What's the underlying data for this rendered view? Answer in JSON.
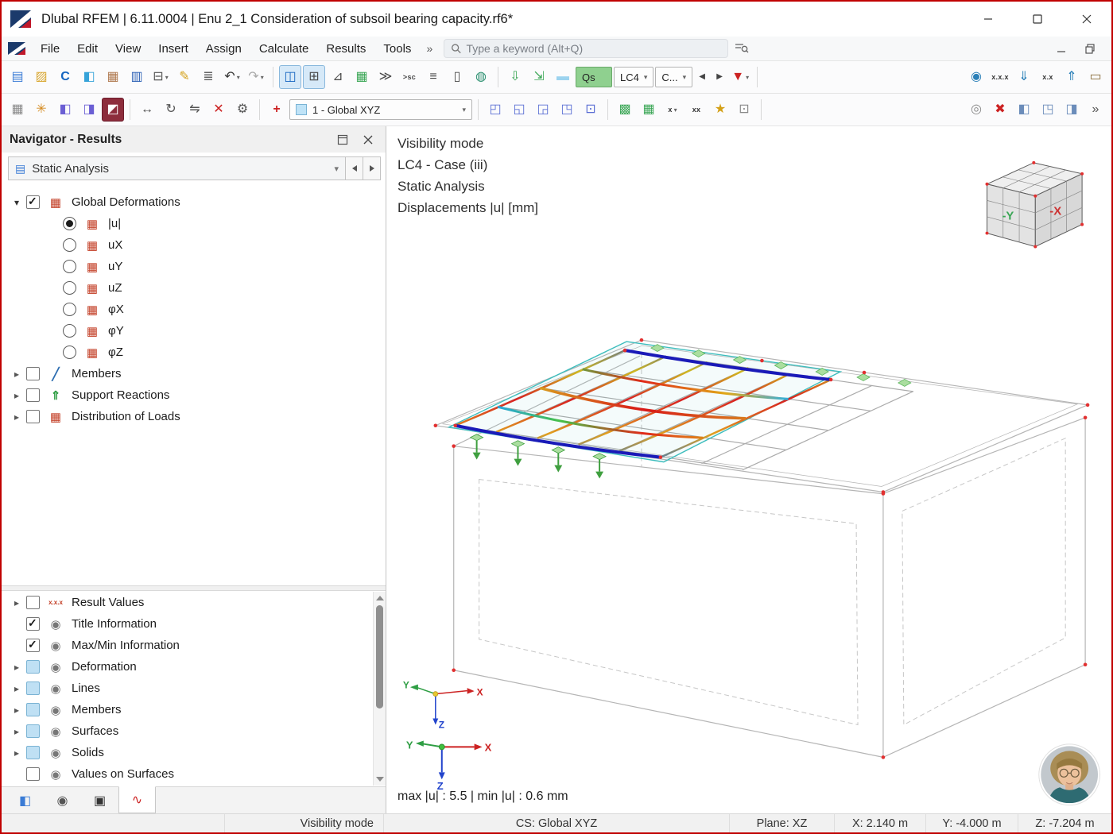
{
  "window": {
    "title": "Dlubal RFEM | 6.11.0004 | Enu 2_1 Consideration of subsoil bearing capacity.rf6*"
  },
  "menubar": {
    "items": [
      {
        "name": "menu-file",
        "label": "File"
      },
      {
        "name": "menu-edit",
        "label": "Edit"
      },
      {
        "name": "menu-view",
        "label": "View"
      },
      {
        "name": "menu-insert",
        "label": "Insert"
      },
      {
        "name": "menu-assign",
        "label": "Assign"
      },
      {
        "name": "menu-calculate",
        "label": "Calculate"
      },
      {
        "name": "menu-results",
        "label": "Results"
      },
      {
        "name": "menu-tools",
        "label": "Tools"
      }
    ],
    "overflow": "»",
    "search": {
      "placeholder": "Type a keyword (Alt+Q)"
    }
  },
  "toolbar_main": {
    "items": [
      {
        "name": "new-model-button",
        "label": "▤",
        "color": "#3a7bd5"
      },
      {
        "name": "open-model-button",
        "label": "▨",
        "color": "#d9a62e"
      },
      {
        "name": "dlubal-center-button",
        "label": "C",
        "color": "#1565c0",
        "cls": "bold"
      },
      {
        "name": "model-library-button",
        "label": "◧",
        "color": "#36a3d9"
      },
      {
        "name": "printout-graphic-button",
        "label": "▦",
        "color": "#b07a50"
      },
      {
        "name": "save-button",
        "label": "▥",
        "color": "#2a5fb4"
      },
      {
        "name": "print-button",
        "label": "⊟",
        "color": "#555",
        "cls": "dd"
      },
      {
        "name": "comment-button",
        "label": "✎",
        "color": "#d4a017"
      },
      {
        "name": "printout-report-button",
        "label": "≣",
        "color": "#666"
      },
      {
        "name": "undo-button",
        "label": "↶",
        "color": "#333",
        "cls": "dd"
      },
      {
        "name": "redo-button",
        "label": "↷",
        "color": "#a8a8a8",
        "cls": "dd"
      },
      {
        "name": "toolbar-separator",
        "cls": "sep",
        "interactable": false
      },
      {
        "name": "navigator-panel-toggle",
        "label": "◫",
        "color": "#1565c0",
        "cls": "active"
      },
      {
        "name": "tables-panel-toggle",
        "label": "⊞",
        "color": "#4a4a4a",
        "cls": "active"
      },
      {
        "name": "result-diagram-button",
        "label": "⊿",
        "color": "#4a4a4a"
      },
      {
        "name": "result-tables-button",
        "label": "▦",
        "color": "#3aa655"
      },
      {
        "name": "export-tables-button",
        "label": "≫",
        "color": "#4a4a4a"
      },
      {
        "name": "export-sc-button",
        "label": ">sc",
        "color": "#4a4a4a",
        "cls": "small-text"
      },
      {
        "name": "layers-button",
        "label": "≡",
        "color": "#4a4a4a"
      },
      {
        "name": "report-button",
        "label": "▯",
        "color": "#4a4a4a"
      },
      {
        "name": "online-services-button",
        "label": "◍",
        "color": "#2a8f6f"
      },
      {
        "name": "toolbar-separator",
        "cls": "sep",
        "interactable": false
      },
      {
        "name": "load-cases-button",
        "label": "⇩",
        "color": "#3aa655"
      },
      {
        "name": "load-wizard-button",
        "label": "⇲",
        "color": "#3aa655"
      },
      {
        "name": "color-scale-swatch",
        "label": "▬",
        "color": "#9cd3ef"
      },
      {
        "name": "load-symbol-combo",
        "label": "Qs",
        "cls": "combo green"
      },
      {
        "name": "load-case-combo",
        "label": "LC4",
        "cls": "combo dd"
      },
      {
        "name": "case-filter-combo",
        "label": "C...",
        "cls": "combo dd"
      },
      {
        "name": "previous-case-button",
        "label": "◀",
        "color": "#444",
        "cls": "narrow"
      },
      {
        "name": "next-case-button",
        "label": "▶",
        "color": "#444",
        "cls": "narrow"
      },
      {
        "name": "result-filter-button",
        "label": "▼",
        "color": "#cc2222",
        "cls": "dd"
      },
      {
        "name": "toolbar-separator",
        "cls": "sep",
        "interactable": false
      },
      {
        "name": "show-result-values-button",
        "label": "◉",
        "color": "#2a7fb8",
        "cls": "mla"
      },
      {
        "name": "result-values-settings-button",
        "label": "x.x.x",
        "color": "#333",
        "cls": "small-text"
      },
      {
        "name": "min-max-values-button",
        "label": "⇓",
        "color": "#2a7fb8"
      },
      {
        "name": "decimal-places-button",
        "label": "x.x",
        "color": "#333",
        "cls": "small-text"
      },
      {
        "name": "result-export-button",
        "label": "⇑",
        "color": "#2a7fb8"
      },
      {
        "name": "materials-cart-button",
        "label": "▭",
        "color": "#8a6d3b"
      }
    ]
  },
  "toolbar_edit": {
    "items": [
      {
        "name": "display-grid-button",
        "label": "▦",
        "color": "#8a8a8a"
      },
      {
        "name": "snap-settings-button",
        "label": "✳",
        "color": "#d48a1f"
      },
      {
        "name": "workplane-xy-button",
        "label": "◧",
        "color": "#6b5fd4"
      },
      {
        "name": "workplane-xz-button",
        "label": "◨",
        "color": "#6b5fd4"
      },
      {
        "name": "workplane-yz-button",
        "label": "◩",
        "color": "#ffffff",
        "cls": "active-red"
      },
      {
        "name": "toolbar-separator",
        "cls": "sep",
        "interactable": false
      },
      {
        "name": "measure-button",
        "label": "↔",
        "color": "#555"
      },
      {
        "name": "rotate-view-button",
        "label": "↻",
        "color": "#555"
      },
      {
        "name": "mirror-button",
        "label": "⇋",
        "color": "#555"
      },
      {
        "name": "trim-button",
        "label": "✕",
        "color": "#cc2222"
      },
      {
        "name": "tool-settings-button",
        "label": "⚙",
        "color": "#555"
      },
      {
        "name": "toolbar-separator",
        "cls": "sep",
        "interactable": false
      },
      {
        "name": "coordinate-system-button",
        "label": "+",
        "color": "#cc2222",
        "cls": "bold"
      },
      {
        "name": "coordinate-system-combo",
        "label": "1 - Global XYZ",
        "cls": "combo wide dd"
      },
      {
        "name": "toolbar-separator",
        "cls": "sep",
        "interactable": false
      },
      {
        "name": "new-node-button",
        "label": "◰",
        "color": "#5b6fd4"
      },
      {
        "name": "new-line-button",
        "label": "◱",
        "color": "#5b6fd4"
      },
      {
        "name": "new-surface-button",
        "label": "◲",
        "color": "#5b6fd4"
      },
      {
        "name": "new-opening-button",
        "label": "◳",
        "color": "#5b6fd4"
      },
      {
        "name": "new-solid-button",
        "label": "⊡",
        "color": "#5b6fd4"
      },
      {
        "name": "toolbar-separator",
        "cls": "sep",
        "interactable": false
      },
      {
        "name": "generate-mesh-button",
        "label": "▩",
        "color": "#3aa655"
      },
      {
        "name": "mesh-settings-button",
        "label": "▦",
        "color": "#3aa655"
      },
      {
        "name": "average-regions-button",
        "label": "x",
        "color": "#333",
        "cls": "dd small-text"
      },
      {
        "name": "extreme-values-button",
        "label": "xx",
        "color": "#333",
        "cls": "small-text"
      },
      {
        "name": "new-generated-button",
        "label": "★",
        "color": "#d4a017"
      },
      {
        "name": "generated-objects-button",
        "label": "⊡",
        "color": "#8a8a8a"
      },
      {
        "name": "toolbar-separator",
        "cls": "sep",
        "interactable": false
      },
      {
        "name": "zoom-region-button",
        "label": "◎",
        "color": "#8a8a8a",
        "cls": "mla"
      },
      {
        "name": "delete-results-button",
        "label": "✖",
        "color": "#cc2222"
      },
      {
        "name": "isometric-view-button",
        "label": "◧",
        "color": "#6b8cba"
      },
      {
        "name": "view-in-direction-button",
        "label": "◳",
        "color": "#6b8cba"
      },
      {
        "name": "clipping-box-button",
        "label": "◨",
        "color": "#6b8cba"
      },
      {
        "name": "toolbar-overflow-button",
        "label": "»",
        "color": "#555"
      }
    ]
  },
  "navigator": {
    "title": "Navigator - Results",
    "analysis_selector": "Static Analysis",
    "tree": [
      {
        "name": "tree-item-global-deformations",
        "label": "Global Deformations",
        "cls": "ind-0 exp-open cb-on rd-none",
        "icon": "surface-result"
      },
      {
        "name": "tree-item-u-abs",
        "label": "|u|",
        "cls": "ind-1 exp-none cb-none rd-on",
        "icon": "surface-result"
      },
      {
        "name": "tree-item-ux",
        "label": "uX",
        "cls": "ind-1 exp-none cb-none rd-off",
        "icon": "surface-result"
      },
      {
        "name": "tree-item-uy",
        "label": "uY",
        "cls": "ind-1 exp-none cb-none rd-off",
        "icon": "surface-result"
      },
      {
        "name": "tree-item-uz",
        "label": "uZ",
        "cls": "ind-1 exp-none cb-none rd-off",
        "icon": "surface-result"
      },
      {
        "name": "tree-item-phix",
        "label": "φX",
        "cls": "ind-1 exp-none cb-none rd-off",
        "icon": "surface-result"
      },
      {
        "name": "tree-item-phiy",
        "label": "φY",
        "cls": "ind-1 exp-none cb-none rd-off",
        "icon": "surface-result"
      },
      {
        "name": "tree-item-phiz",
        "label": "φZ",
        "cls": "ind-1 exp-none cb-none rd-off",
        "icon": "surface-result"
      },
      {
        "name": "tree-item-members",
        "label": "Members",
        "cls": "ind-0 exp-closed cb-off rd-none",
        "icon": "member-result"
      },
      {
        "name": "tree-item-support-reactions",
        "label": "Support Reactions",
        "cls": "ind-0 exp-closed cb-off rd-none",
        "icon": "support-reaction"
      },
      {
        "name": "tree-item-distribution-of-loads",
        "label": "Distribution of Loads",
        "cls": "ind-0 exp-closed cb-off rd-none",
        "icon": "surface-result"
      }
    ],
    "display_tree": [
      {
        "name": "tree-item-result-values",
        "label": "Result Values",
        "cls": "ind-0 exp-closed cb-off rd-none",
        "icon": "result-values"
      },
      {
        "name": "tree-item-title-information",
        "label": "Title Information",
        "cls": "ind-0 exp-none cb-on rd-none",
        "icon": "display"
      },
      {
        "name": "tree-item-maxmin-information",
        "label": "Max/Min Information",
        "cls": "ind-0 exp-none cb-on rd-none",
        "icon": "display"
      },
      {
        "name": "tree-item-deformation",
        "label": "Deformation",
        "cls": "ind-0 exp-closed cb-mix rd-none",
        "icon": "display"
      },
      {
        "name": "tree-item-lines",
        "label": "Lines",
        "cls": "ind-0 exp-closed cb-mix rd-none",
        "icon": "display"
      },
      {
        "name": "tree-item-members-display",
        "label": "Members",
        "cls": "ind-0 exp-closed cb-mix rd-none",
        "icon": "display"
      },
      {
        "name": "tree-item-surfaces",
        "label": "Surfaces",
        "cls": "ind-0 exp-closed cb-mix rd-none",
        "icon": "display"
      },
      {
        "name": "tree-item-solids",
        "label": "Solids",
        "cls": "ind-0 exp-closed cb-mix rd-none",
        "icon": "display"
      },
      {
        "name": "tree-item-values-on-surfaces",
        "label": "Values on Surfaces",
        "cls": "ind-0 exp-none cb-off rd-none",
        "icon": "display"
      }
    ],
    "tabs": [
      {
        "name": "tab-data",
        "label": "◧",
        "color": "#3a7bd5"
      },
      {
        "name": "tab-display",
        "label": "◉",
        "color": "#555555"
      },
      {
        "name": "tab-views",
        "label": "▣",
        "color": "#333333"
      },
      {
        "name": "tab-results",
        "label": "∿",
        "color": "#cc2222",
        "cls": "active"
      }
    ]
  },
  "viewport": {
    "info_lines": [
      {
        "text": "Visibility mode"
      },
      {
        "text": "LC4 - Case (iii)"
      },
      {
        "text": "Static Analysis"
      },
      {
        "text": "Displacements |u| [mm]"
      }
    ],
    "minmax_line": "max |u| : 5.5 | min |u| : 0.6 mm",
    "navcube": {
      "left_label": "-Y",
      "right_label": "-X"
    },
    "axes": {
      "x": "X",
      "y": "Y",
      "z": "Z"
    }
  },
  "statusbar": {
    "mode": "Visibility mode",
    "cs": "CS: Global XYZ",
    "plane": "Plane: XZ",
    "coord_x": "X: 2.140 m",
    "coord_y": "Y: -4.000 m",
    "coord_z": "Z: -7.204 m"
  },
  "colors": {
    "accent_red": "#c00000",
    "selection_green": "#8fd08f",
    "highlight_blue": "#d6e9f8"
  }
}
